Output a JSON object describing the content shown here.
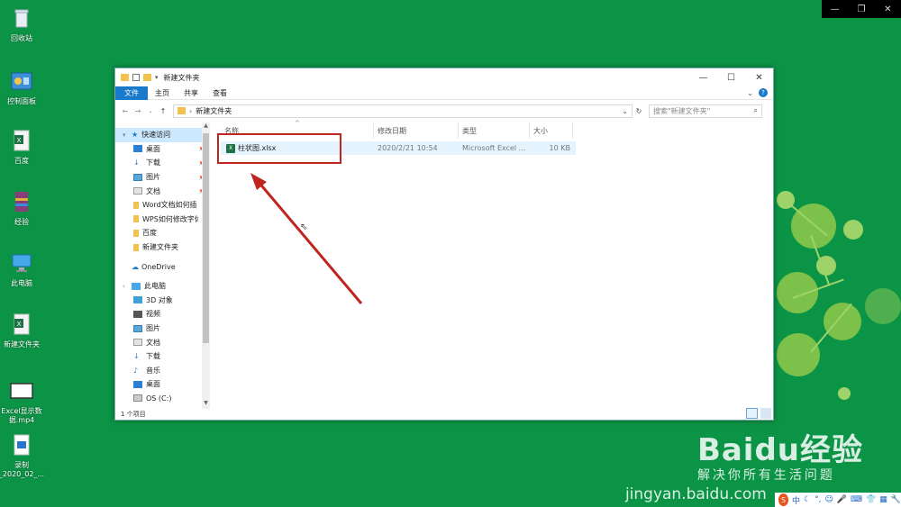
{
  "desktop": {
    "icons": [
      {
        "label": "回收站"
      },
      {
        "label": "控制面板"
      },
      {
        "label": "百度"
      },
      {
        "label": "经验"
      },
      {
        "label": "此电脑"
      },
      {
        "label": "新建文件夹"
      },
      {
        "label": "Excel显示数据.mp4"
      },
      {
        "label": "录制_2020_02_..."
      }
    ]
  },
  "window": {
    "title": "新建文件夹",
    "ribbon_tabs": [
      "文件",
      "主页",
      "共享",
      "查看"
    ],
    "address_crumb": "新建文件夹",
    "search_placeholder": "搜索\"新建文件夹\"",
    "columns": [
      "名称",
      "修改日期",
      "类型",
      "大小"
    ],
    "nav": {
      "quick_access": "快速访问",
      "quick_items": [
        "桌面",
        "下载",
        "图片",
        "文档",
        "Word文档如何插",
        "WPS如何修改字体",
        "百度",
        "新建文件夹"
      ],
      "onedrive": "OneDrive",
      "this_pc": "此电脑",
      "pc_items": [
        "3D 对象",
        "视频",
        "图片",
        "文档",
        "下载",
        "音乐",
        "桌面",
        "OS (C:)"
      ]
    },
    "files": [
      {
        "name": "柱状图.xlsx",
        "modified": "2020/2/21 10:54",
        "type": "Microsoft Excel ...",
        "size": "10 KB"
      }
    ],
    "status": "1 个项目"
  },
  "watermark": {
    "logo": "Baidu经验",
    "slogan": "解决你所有生活问题",
    "url": "jingyan.baidu.com"
  },
  "tray": {
    "ime": "中"
  },
  "colors": {
    "desktop_bg": "#0c9446",
    "accent": "#1979ca",
    "annotation": "#c0241e",
    "selection": "#e5f3ff"
  }
}
